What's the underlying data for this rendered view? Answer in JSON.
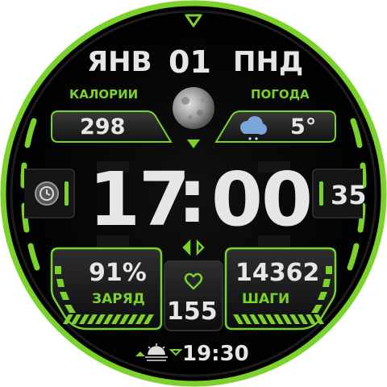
{
  "colors": {
    "accent": "#7bd22a",
    "text": "#e6e6e6",
    "background": "#050505"
  },
  "date": {
    "month": "ЯНВ",
    "day": "01",
    "weekday": "ПНД"
  },
  "calories": {
    "label": "КАЛОРИИ",
    "value": "298"
  },
  "weather": {
    "label": "ПОГОДА",
    "temperature": "5°",
    "icon": "cloud-snow-icon"
  },
  "moon": {
    "icon": "moon-phase-icon"
  },
  "time": {
    "hours": "17",
    "separator": ":",
    "minutes": "00",
    "seconds": "35"
  },
  "alarm": {
    "icon": "alarm-clock-icon"
  },
  "battery": {
    "label": "ЗАРЯД",
    "value": "91%"
  },
  "steps": {
    "label": "ШАГИ",
    "value": "14362"
  },
  "heart": {
    "icon": "heart-icon",
    "value": "155"
  },
  "sun": {
    "icon": "sunrise-sunset-icon",
    "time": "19:30"
  }
}
